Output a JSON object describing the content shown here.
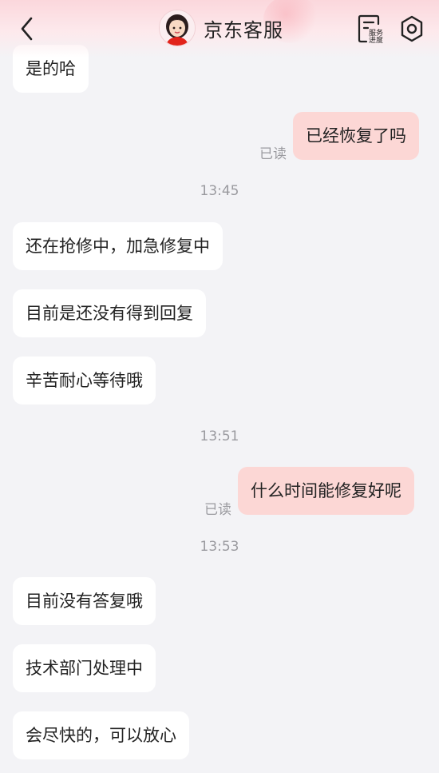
{
  "header": {
    "title": "京东客服",
    "service_label_line1": "服务",
    "service_label_line2": "进度",
    "accent": "#e2231a"
  },
  "messages": [
    {
      "side": "in",
      "text": "是的哈"
    },
    {
      "side": "out",
      "text": "已经恢复了吗",
      "status": "已读"
    },
    {
      "timestamp": "13:45"
    },
    {
      "side": "in",
      "text": "还在抢修中，加急修复中"
    },
    {
      "side": "in",
      "text": "目前是还没有得到回复"
    },
    {
      "side": "in",
      "text": "辛苦耐心等待哦"
    },
    {
      "timestamp": "13:51"
    },
    {
      "side": "out",
      "text": "什么时间能修复好呢",
      "status": "已读"
    },
    {
      "timestamp": "13:53"
    },
    {
      "side": "in",
      "text": "目前没有答复哦"
    },
    {
      "side": "in",
      "text": "技术部门处理中"
    },
    {
      "side": "in",
      "text": "会尽快的，可以放心"
    }
  ],
  "colors": {
    "incoming_bubble": "#ffffff",
    "outgoing_bubble": "#fcd7d5",
    "background": "#f3f3f6",
    "meta_text": "#9a9a9f"
  }
}
